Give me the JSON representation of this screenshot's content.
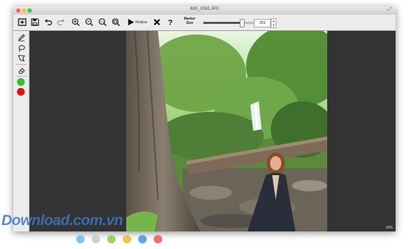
{
  "window": {
    "title": "IMG_0063.JPG"
  },
  "traffic_lights": {
    "close": "#fc605c",
    "minimize": "#fdbc40",
    "zoom": "#34c84a"
  },
  "toolbar": {
    "buttons": [
      {
        "name": "open-icon"
      },
      {
        "name": "save-icon"
      },
      {
        "name": "undo-icon"
      },
      {
        "name": "redo-icon"
      },
      {
        "name": "zoom-in-icon"
      },
      {
        "name": "zoom-out-icon"
      },
      {
        "name": "zoom-actual-icon"
      },
      {
        "name": "zoom-fit-icon"
      }
    ],
    "run_label": "Realize",
    "marker_label_line1": "Marker",
    "marker_label_line2": "Size",
    "marker_size_value": "253",
    "marker_size_fraction": 0.62
  },
  "sidebar": {
    "tools": [
      "brush-icon",
      "lasso-icon",
      "polygon-lasso-icon",
      "eraser-icon"
    ],
    "keep_color": "#2ec22e",
    "remove_color": "#e01010"
  },
  "status": {
    "zoom": "18%"
  },
  "watermark": {
    "text": "Download.com.vn",
    "dot_colors": [
      "#7ec8ef",
      "#d0d0d0",
      "#9bd46b",
      "#f6c24a",
      "#5aa7e2",
      "#ef6d6d"
    ]
  }
}
